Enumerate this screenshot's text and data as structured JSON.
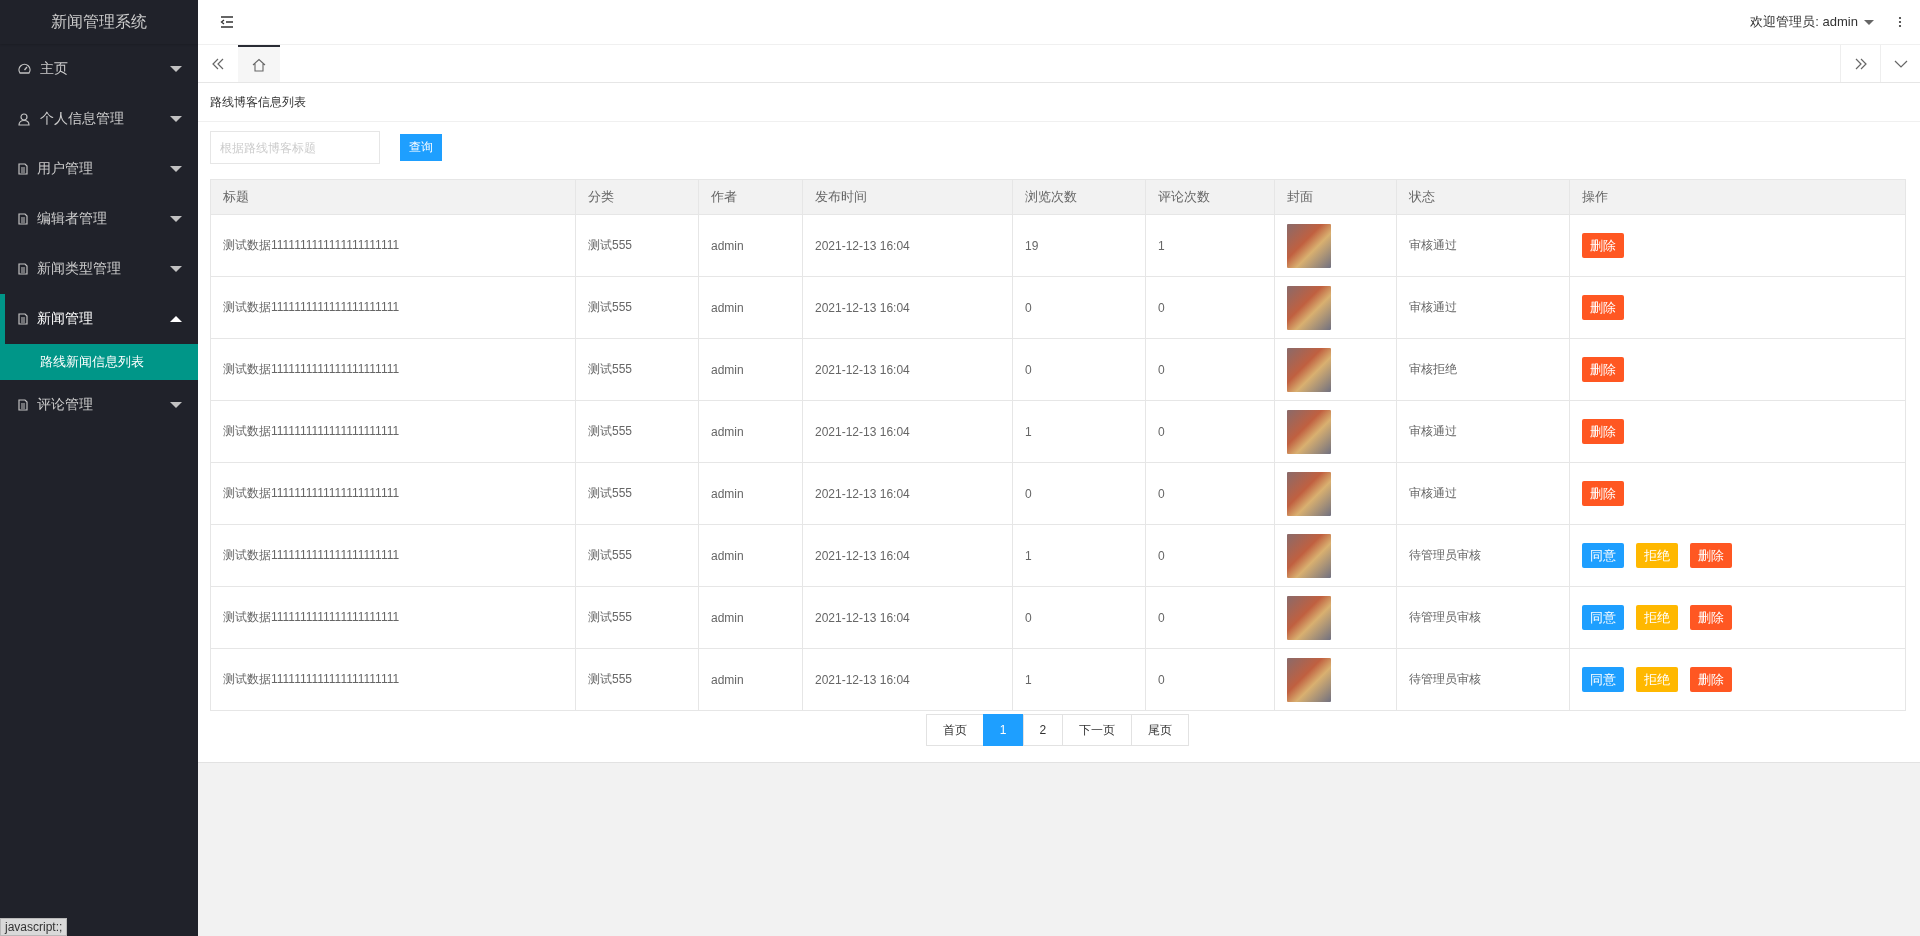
{
  "sidebar": {
    "title": "新闻管理系统",
    "items": [
      {
        "label": "主页",
        "kind": "gauge",
        "expanded": false,
        "selected": false
      },
      {
        "label": "个人信息管理",
        "kind": "user",
        "expanded": false,
        "selected": false
      },
      {
        "label": "用户管理",
        "kind": "doc",
        "expanded": false,
        "selected": false
      },
      {
        "label": "编辑者管理",
        "kind": "doc",
        "expanded": false,
        "selected": false
      },
      {
        "label": "新闻类型管理",
        "kind": "doc",
        "expanded": false,
        "selected": false
      },
      {
        "label": "新闻管理",
        "kind": "doc",
        "expanded": true,
        "selected": true,
        "children": [
          {
            "label": "路线新闻信息列表",
            "selected": true
          }
        ]
      },
      {
        "label": "评论管理",
        "kind": "doc",
        "expanded": false,
        "selected": false
      }
    ]
  },
  "header": {
    "welcome": "欢迎管理员: admin"
  },
  "tabs": [
    {
      "kind": "home",
      "selected": true
    }
  ],
  "page_title": "路线博客信息列表",
  "search": {
    "placeholder": "根据路线博客标题",
    "button": "查询"
  },
  "table": {
    "columns": [
      "标题",
      "分类",
      "作者",
      "发布时间",
      "浏览次数",
      "评论次数",
      "封面",
      "状态",
      "操作"
    ],
    "rows": [
      {
        "title": "测试数据1111111111111111111111",
        "category": "测试555",
        "author": "admin",
        "time": "2021-12-13 16:04",
        "views": "19",
        "comments": "1",
        "status": "审核通过",
        "actions": [
          {
            "kind": "delete",
            "label": "删除"
          }
        ]
      },
      {
        "title": "测试数据1111111111111111111111",
        "category": "测试555",
        "author": "admin",
        "time": "2021-12-13 16:04",
        "views": "0",
        "comments": "0",
        "status": "审核通过",
        "actions": [
          {
            "kind": "delete",
            "label": "删除"
          }
        ]
      },
      {
        "title": "测试数据1111111111111111111111",
        "category": "测试555",
        "author": "admin",
        "time": "2021-12-13 16:04",
        "views": "0",
        "comments": "0",
        "status": "审核拒绝",
        "actions": [
          {
            "kind": "delete",
            "label": "删除"
          }
        ]
      },
      {
        "title": "测试数据1111111111111111111111",
        "category": "测试555",
        "author": "admin",
        "time": "2021-12-13 16:04",
        "views": "1",
        "comments": "0",
        "status": "审核通过",
        "actions": [
          {
            "kind": "delete",
            "label": "删除"
          }
        ]
      },
      {
        "title": "测试数据1111111111111111111111",
        "category": "测试555",
        "author": "admin",
        "time": "2021-12-13 16:04",
        "views": "0",
        "comments": "0",
        "status": "审核通过",
        "actions": [
          {
            "kind": "delete",
            "label": "删除"
          }
        ]
      },
      {
        "title": "测试数据1111111111111111111111",
        "category": "测试555",
        "author": "admin",
        "time": "2021-12-13 16:04",
        "views": "1",
        "comments": "0",
        "status": "待管理员审核",
        "actions": [
          {
            "kind": "approve",
            "label": "同意"
          },
          {
            "kind": "reject",
            "label": "拒绝"
          },
          {
            "kind": "delete",
            "label": "删除"
          }
        ]
      },
      {
        "title": "测试数据1111111111111111111111",
        "category": "测试555",
        "author": "admin",
        "time": "2021-12-13 16:04",
        "views": "0",
        "comments": "0",
        "status": "待管理员审核",
        "actions": [
          {
            "kind": "approve",
            "label": "同意"
          },
          {
            "kind": "reject",
            "label": "拒绝"
          },
          {
            "kind": "delete",
            "label": "删除"
          }
        ]
      },
      {
        "title": "测试数据1111111111111111111111",
        "category": "测试555",
        "author": "admin",
        "time": "2021-12-13 16:04",
        "views": "1",
        "comments": "0",
        "status": "待管理员审核",
        "actions": [
          {
            "kind": "approve",
            "label": "同意"
          },
          {
            "kind": "reject",
            "label": "拒绝"
          },
          {
            "kind": "delete",
            "label": "删除"
          }
        ]
      }
    ]
  },
  "pagination": [
    {
      "label": "首页",
      "selected": false
    },
    {
      "label": "1",
      "selected": true
    },
    {
      "label": "2",
      "selected": false
    },
    {
      "label": "下一页",
      "selected": false
    },
    {
      "label": "尾页",
      "selected": false
    }
  ],
  "status_bar": "javascript:;"
}
